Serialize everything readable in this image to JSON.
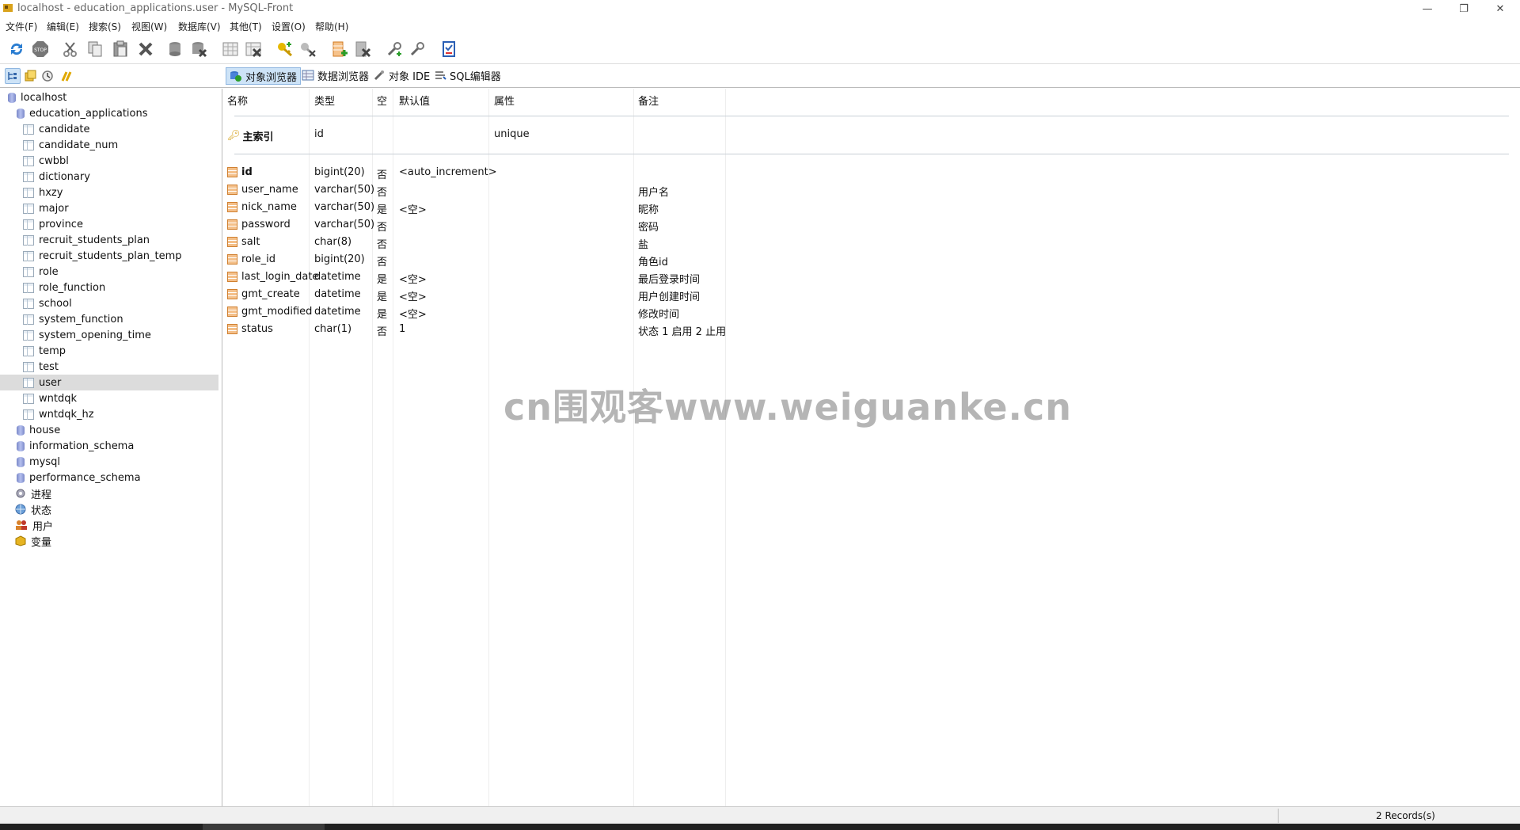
{
  "window": {
    "title": "localhost - education_applications.user - MySQL-Front",
    "min": "—",
    "max": "❐",
    "close": "✕"
  },
  "menu": [
    "文件(F)",
    "编辑(E)",
    "搜索(S)",
    "视图(W)",
    "数据库(V)",
    "其他(T)",
    "设置(O)",
    "帮助(H)"
  ],
  "toolbar": {
    "icons": [
      "refresh-icon",
      "stop-icon",
      "cut-icon",
      "copy-icon",
      "paste-icon",
      "delete-icon",
      "db-new-icon",
      "db-delete-icon",
      "table-new-icon",
      "table-delete-icon",
      "key-new-icon",
      "key-delete-icon",
      "field-new-icon",
      "field-delete-icon",
      "link-new-icon",
      "link-delete-icon",
      "checklist-icon"
    ],
    "stop_label": "STOP"
  },
  "view_tabs": [
    {
      "label": "对象浏览器",
      "selected": true
    },
    {
      "label": "数据浏览器",
      "selected": false
    },
    {
      "label": "对象 IDE",
      "selected": false
    },
    {
      "label": "SQL编辑器",
      "selected": false
    }
  ],
  "tree": {
    "root": "localhost",
    "database": "education_applications",
    "tables": [
      "candidate",
      "candidate_num",
      "cwbbl",
      "dictionary",
      "hxzy",
      "major",
      "province",
      "recruit_students_plan",
      "recruit_students_plan_temp",
      "role",
      "role_function",
      "school",
      "system_function",
      "system_opening_time",
      "temp",
      "test",
      "user",
      "wntdqk",
      "wntdqk_hz"
    ],
    "selected_table": "user",
    "other_dbs": [
      "house",
      "information_schema",
      "mysql",
      "performance_schema"
    ],
    "extras": [
      "进程",
      "状态",
      "用户",
      "变量"
    ]
  },
  "columns": {
    "name": "名称",
    "type": "类型",
    "null": "空",
    "default": "默认值",
    "attr": "属性",
    "comment": "备注"
  },
  "index": {
    "name": "主索引",
    "field": "id",
    "attr": "unique"
  },
  "fields": [
    {
      "name": "id",
      "type": "bigint(20)",
      "null": "否",
      "default": "<auto_increment>",
      "comment": ""
    },
    {
      "name": "user_name",
      "type": "varchar(50)",
      "null": "否",
      "default": "",
      "comment": "用户名"
    },
    {
      "name": "nick_name",
      "type": "varchar(50)",
      "null": "是",
      "default": "<空>",
      "comment": "昵称"
    },
    {
      "name": "password",
      "type": "varchar(50)",
      "null": "否",
      "default": "",
      "comment": "密码"
    },
    {
      "name": "salt",
      "type": "char(8)",
      "null": "否",
      "default": "",
      "comment": "盐"
    },
    {
      "name": "role_id",
      "type": "bigint(20)",
      "null": "否",
      "default": "",
      "comment": "角色id"
    },
    {
      "name": "last_login_date",
      "type": "datetime",
      "null": "是",
      "default": "<空>",
      "comment": "最后登录时间"
    },
    {
      "name": "gmt_create",
      "type": "datetime",
      "null": "是",
      "default": "<空>",
      "comment": "用户创建时间"
    },
    {
      "name": "gmt_modified",
      "type": "datetime",
      "null": "是",
      "default": "<空>",
      "comment": "修改时间"
    },
    {
      "name": "status",
      "type": "char(1)",
      "null": "否",
      "default": "1",
      "comment": "状态 1 启用 2 止用"
    }
  ],
  "status": {
    "records": "2 Records(s)"
  },
  "watermark": "cn围观客www.weiguanke.cn"
}
